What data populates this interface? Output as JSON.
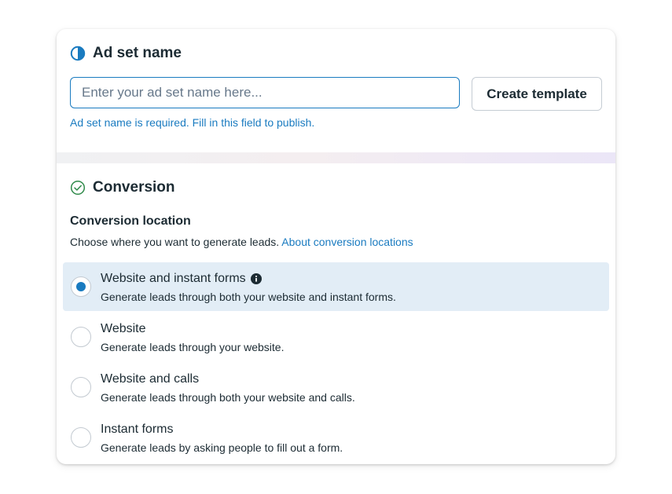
{
  "ad_set": {
    "title": "Ad set name",
    "icon": "half-circle-icon",
    "input_value": "",
    "input_placeholder": "Enter your ad set name here...",
    "create_template_label": "Create template",
    "helper_text": "Ad set name is required. Fill in this field to publish."
  },
  "conversion": {
    "title": "Conversion",
    "icon": "check-circle-icon",
    "location_heading": "Conversion location",
    "description": "Choose where you want to generate leads.",
    "about_link": "About conversion locations",
    "options": [
      {
        "label": "Website and instant forms",
        "desc": "Generate leads through both your website and instant forms.",
        "selected": true,
        "has_info": true
      },
      {
        "label": "Website",
        "desc": "Generate leads through your website.",
        "selected": false
      },
      {
        "label": "Website and calls",
        "desc": "Generate leads through both your website and calls.",
        "selected": false
      },
      {
        "label": "Instant forms",
        "desc": "Generate leads by asking people to fill out a form.",
        "selected": false
      }
    ]
  },
  "colors": {
    "accent": "#1a7bc0",
    "text": "#1c2b33",
    "selected_bg": "#e2edf6"
  }
}
